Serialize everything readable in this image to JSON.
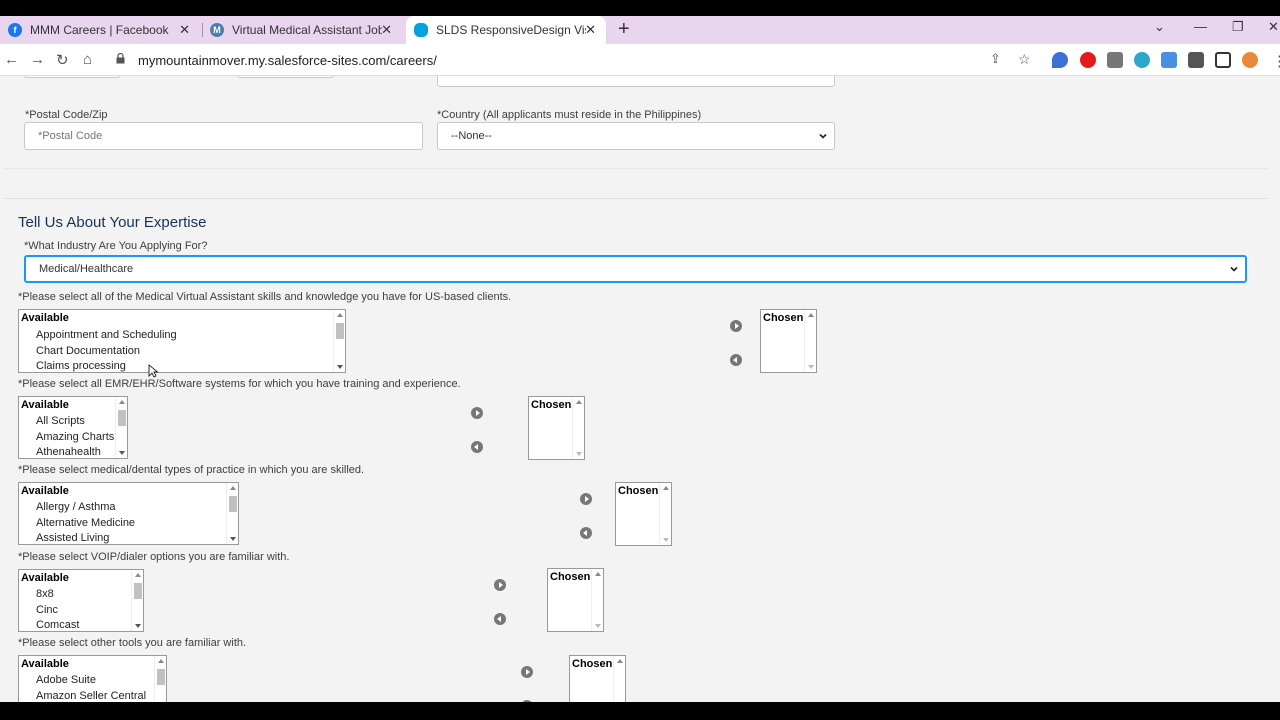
{
  "browser": {
    "tabs": [
      {
        "title": "MMM Careers | Facebook",
        "icon": "facebook-icon",
        "active": false
      },
      {
        "title": "Virtual Medical Assistant Jobs - N",
        "icon": "mmm-favicon",
        "active": false
      },
      {
        "title": "SLDS ResponsiveDesign Visualfor",
        "icon": "salesforce-icon",
        "active": true
      }
    ],
    "url": "mymountainmover.my.salesforce-sites.com/careers/"
  },
  "form": {
    "postal_label": "*Postal Code/Zip",
    "postal_placeholder": "*Postal Code",
    "country_label": "*Country (All applicants must reside in the Philippines)",
    "country_value": "--None--",
    "section_title": "Tell Us About Your Expertise",
    "industry_label": "*What Industry Are You Applying For?",
    "industry_value": "Medical/Healthcare",
    "picklists": [
      {
        "label": "*Please select all of the Medical Virtual Assistant skills and knowledge you have for US-based clients.",
        "available_header": "Available",
        "options": [
          "Appointment and Scheduling",
          "Chart Documentation",
          "Claims processing"
        ],
        "chosen_header": "Chosen"
      },
      {
        "label": "*Please select all EMR/EHR/Software systems for which you have training and experience.",
        "available_header": "Available",
        "options": [
          "All Scripts",
          "Amazing Charts",
          "Athenahealth"
        ],
        "chosen_header": "Chosen"
      },
      {
        "label": "*Please select medical/dental types of practice in which you are skilled.",
        "available_header": "Available",
        "options": [
          "Allergy / Asthma",
          "Alternative Medicine",
          "Assisted Living"
        ],
        "chosen_header": "Chosen"
      },
      {
        "label": "*Please select VOIP/dialer options you are familiar with.",
        "available_header": "Available",
        "options": [
          "8x8",
          "Cinc",
          "Comcast"
        ],
        "chosen_header": "Chosen"
      },
      {
        "label": "*Please select other tools you are familiar with.",
        "available_header": "Available",
        "options": [
          "Adobe Suite",
          "Amazon Seller Central"
        ],
        "chosen_header": "Chosen"
      }
    ]
  }
}
